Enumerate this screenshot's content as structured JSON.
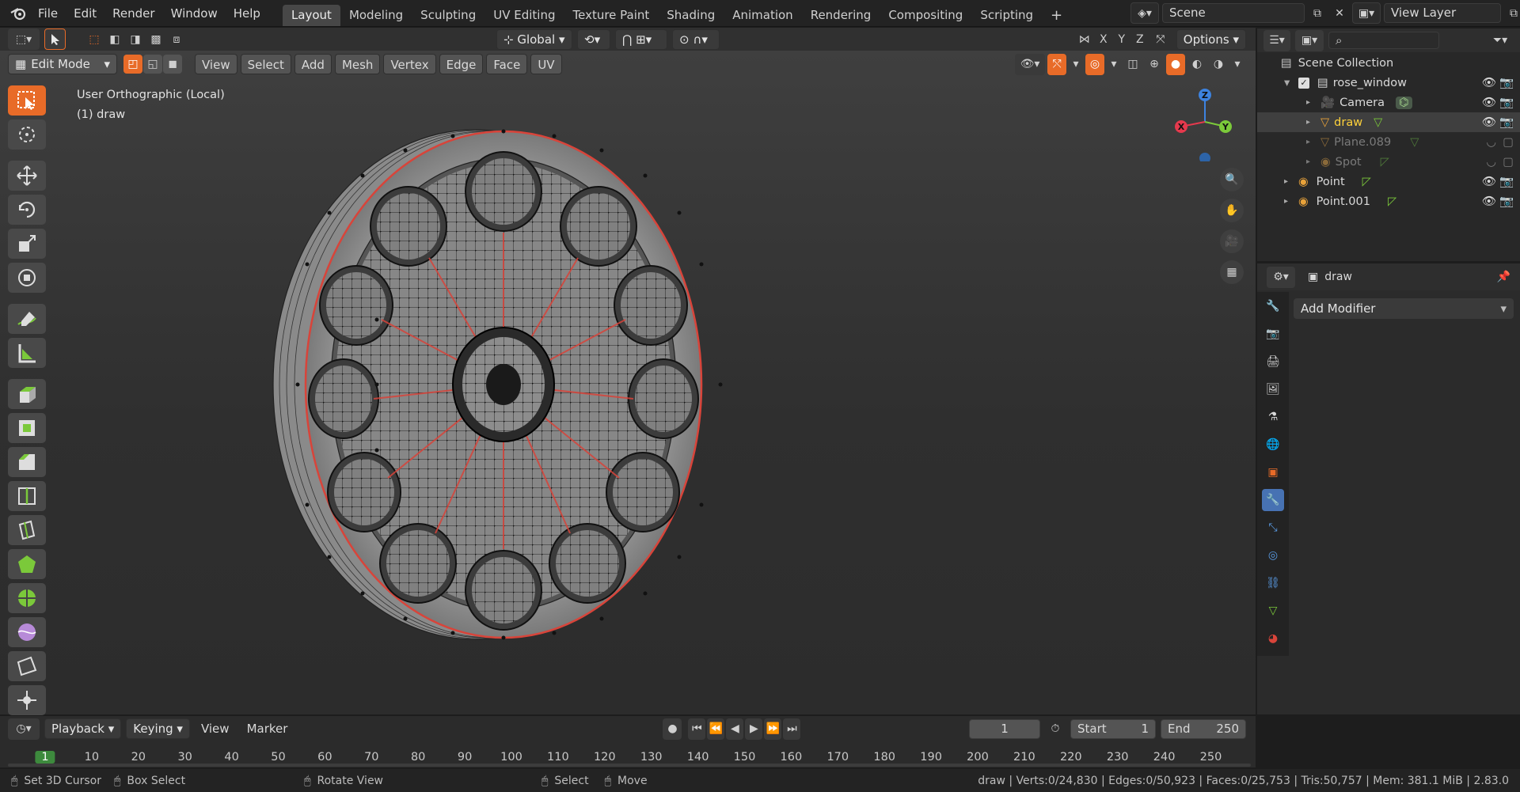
{
  "topbar": {
    "menus": [
      "File",
      "Edit",
      "Render",
      "Window",
      "Help"
    ],
    "workspaces": [
      "Layout",
      "Modeling",
      "Sculpting",
      "UV Editing",
      "Texture Paint",
      "Shading",
      "Animation",
      "Rendering",
      "Compositing",
      "Scripting"
    ],
    "add_tab": "+",
    "scene_name": "Scene",
    "view_layer": "View Layer"
  },
  "tool_header": {
    "orientation": "Global",
    "axes": [
      "X",
      "Y",
      "Z"
    ],
    "options": "Options"
  },
  "viewport_header": {
    "mode": "Edit Mode",
    "menus": [
      "View",
      "Select",
      "Add",
      "Mesh",
      "Vertex",
      "Edge",
      "Face",
      "UV"
    ]
  },
  "viewport": {
    "view_name": "User Orthographic (Local)",
    "object_label": "(1) draw",
    "gizmo_axes": [
      "Z",
      "X",
      "Y"
    ],
    "accent_colors": {
      "x": "#e5394d",
      "y": "#7bc93a",
      "z": "#3d83e0",
      "active": "#e86b28"
    }
  },
  "outliner": {
    "search_placeholder": "",
    "root": "Scene Collection",
    "items": [
      {
        "name": "rose_window",
        "type": "collection",
        "visible": true,
        "dim": false
      },
      {
        "name": "Camera",
        "type": "camera",
        "visible": true,
        "dim": false
      },
      {
        "name": "draw",
        "type": "mesh",
        "visible": true,
        "dim": false,
        "active": true
      },
      {
        "name": "Plane.089",
        "type": "mesh",
        "visible": false,
        "dim": true
      },
      {
        "name": "Spot",
        "type": "light",
        "visible": false,
        "dim": true
      },
      {
        "name": "Point",
        "type": "light",
        "visible": true,
        "dim": false
      },
      {
        "name": "Point.001",
        "type": "light",
        "visible": true,
        "dim": false
      }
    ]
  },
  "properties": {
    "object_name": "draw",
    "add_modifier": "Add Modifier"
  },
  "timeline": {
    "menus": [
      "Playback",
      "Keying",
      "View",
      "Marker"
    ],
    "current_frame": "1",
    "start_label": "Start",
    "start": "1",
    "end_label": "End",
    "end": "250",
    "ticks": [
      "1",
      "10",
      "20",
      "30",
      "40",
      "50",
      "60",
      "70",
      "80",
      "90",
      "100",
      "110",
      "120",
      "130",
      "140",
      "150",
      "160",
      "170",
      "180",
      "190",
      "200",
      "210",
      "220",
      "230",
      "240",
      "250"
    ]
  },
  "statusbar": {
    "hints": [
      "Set 3D Cursor",
      "Box Select",
      "Rotate View",
      "Select",
      "Move"
    ],
    "stats": "draw | Verts:0/24,830 | Edges:0/50,923 | Faces:0/25,753 | Tris:50,757 | Mem: 381.1 MiB | 2.83.0"
  }
}
